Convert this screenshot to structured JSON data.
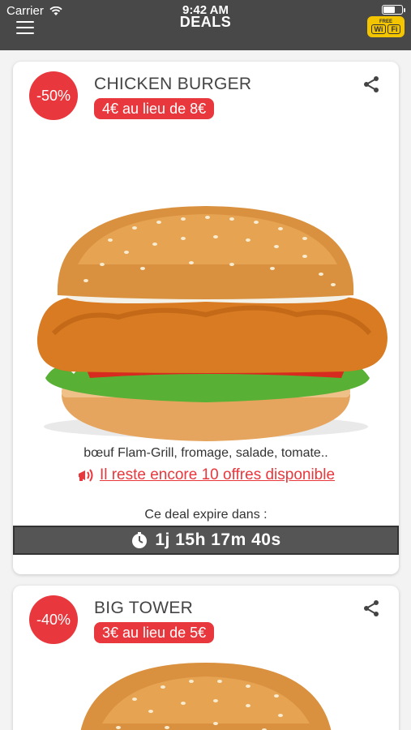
{
  "status_bar": {
    "carrier": "Carrier",
    "time": "9:42 AM"
  },
  "header": {
    "title": "DEALS",
    "wifi_badge": {
      "top": "FREE",
      "left": "Wi",
      "right": "Fi"
    }
  },
  "deals": [
    {
      "discount": "-50%",
      "name": "CHICKEN BURGER",
      "price": "4€ au lieu de 8€",
      "description": "bœuf Flam-Grill, fromage, salade, tomate..",
      "offers": "Il reste encore 10 offres disponible",
      "expire_label": "Ce deal expire dans :",
      "countdown": "1j 15h 17m 40s"
    },
    {
      "discount": "-40%",
      "name": "BIG TOWER",
      "price": "3€ au lieu de 5€"
    }
  ],
  "colors": {
    "accent": "#e8383d",
    "header_bg": "#484848",
    "countdown_bg": "#555555"
  },
  "icons": [
    "menu-icon",
    "share-icon",
    "megaphone-icon",
    "stopwatch-icon",
    "wifi-icon",
    "battery-icon"
  ]
}
